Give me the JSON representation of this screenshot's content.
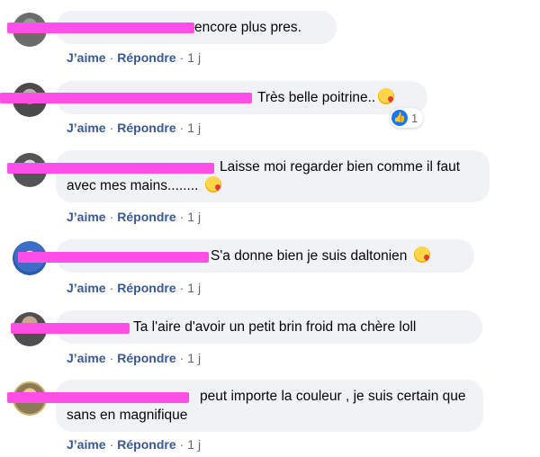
{
  "actions": {
    "like": "J’aime",
    "reply": "Répondre",
    "sep": "·",
    "time": "1 j"
  },
  "colors": {
    "redaction": "#ff4fe6",
    "bubble": "#f0f2f5",
    "link": "#385898"
  },
  "comments": [
    {
      "text": "encore plus pres."
    },
    {
      "text": "Très belle poitrine..",
      "reaction_count": "1"
    },
    {
      "text": "Laisse moi regarder bien comme il faut avec mes mains........"
    },
    {
      "text": "S'a donne bien je suis daltonien"
    },
    {
      "text": "Ta l'aire d'avoir un petit brin froid ma chère loll"
    },
    {
      "text": "peut importe la couleur , je suis certain que sans en magnifique"
    }
  ]
}
